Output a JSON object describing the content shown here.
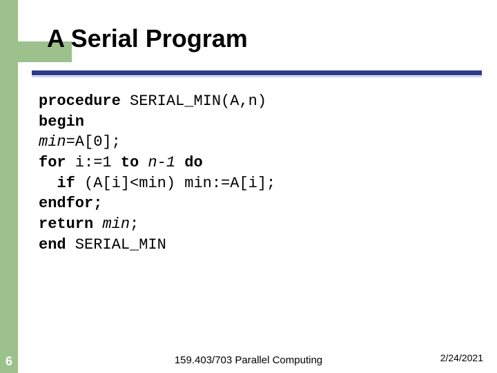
{
  "title": "A Serial Program",
  "code": {
    "l1_kw": "procedure",
    "l1_rest": " SERIAL_MIN(A,n)",
    "l2": "begin",
    "l3_it": "min",
    "l3_rest": "=A[0];",
    "l4_kw1": "for",
    "l4_mid": " i:=1 ",
    "l4_kw2": "to",
    "l4_it": " n-1 ",
    "l4_kw3": "do",
    "l5_indent": "  ",
    "l5_kw": "if",
    "l5_rest": " (A[i]<min) min:=A[i];",
    "l6": "endfor;",
    "l7_kw": "return",
    "l7_it": " min",
    "l7_rest": ";",
    "l8_kw": "end",
    "l8_rest": " SERIAL_MIN"
  },
  "footer": {
    "slide_number": "6",
    "center": "159.403/703 Parallel Computing",
    "date": "2/24/2021"
  }
}
